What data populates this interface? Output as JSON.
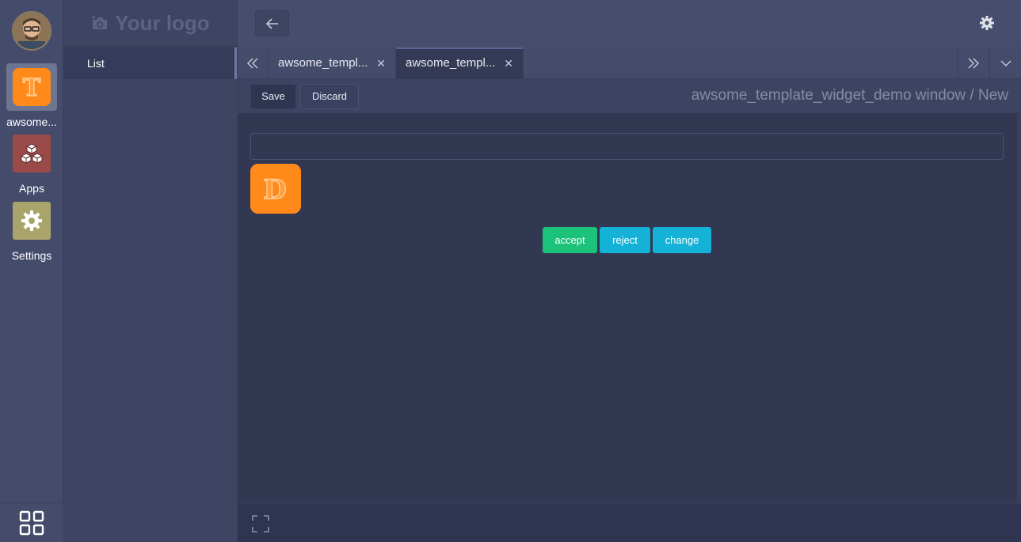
{
  "rail": {
    "apps": [
      {
        "label": "awsome..."
      },
      {
        "label": "Apps"
      },
      {
        "label": "Settings"
      }
    ],
    "icons": {
      "t_color": "#ff8a1a",
      "apps_color": "#9b4a4a",
      "settings_color": "#a9a46a"
    }
  },
  "sidebar": {
    "logo_text": "Your logo",
    "menu": [
      {
        "label": "List"
      }
    ]
  },
  "tabs": [
    {
      "label": "awsome_templ...",
      "active": false
    },
    {
      "label": "awsome_templ...",
      "active": true
    }
  ],
  "toolbar": {
    "save_label": "Save",
    "discard_label": "Discard",
    "breadcrumb": "awsome_template_widget_demo window / New"
  },
  "form": {
    "input_value": "",
    "d_icon_letter": "D",
    "actions": {
      "accept": "accept",
      "reject": "reject",
      "change": "change"
    }
  },
  "colors": {
    "accept": "#1cc17a",
    "reject": "#14b2d6",
    "change": "#14b2d6",
    "brand_orange": "#ff8a1a"
  }
}
